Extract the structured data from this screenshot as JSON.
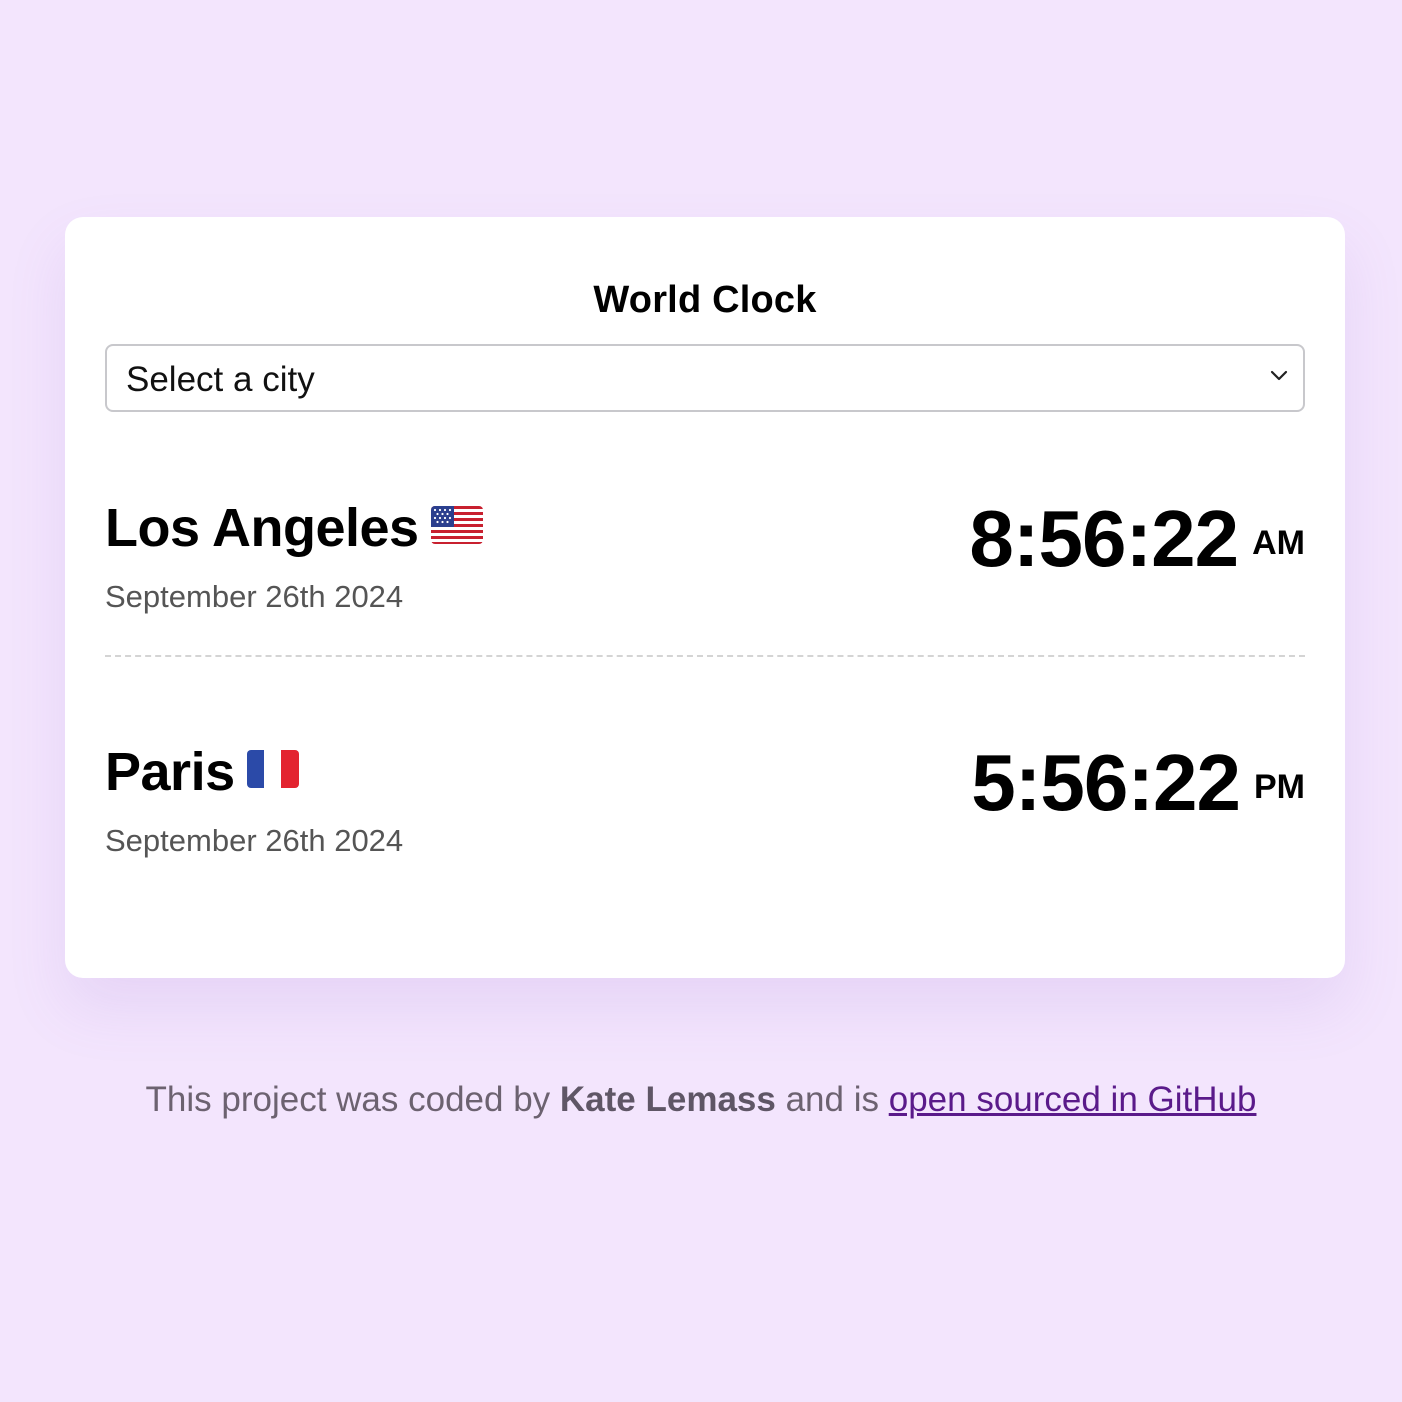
{
  "app": {
    "title": "World Clock"
  },
  "select": {
    "value": "Select a city",
    "icon": "chevron-down-icon"
  },
  "cities": [
    {
      "name": "Los Angeles",
      "flag": "us-flag-icon",
      "date": "September 26th 2024",
      "time": "8:56:22",
      "ampm": "AM"
    },
    {
      "name": "Paris",
      "flag": "france-flag-icon",
      "date": "September 26th 2024",
      "time": "5:56:22",
      "ampm": "PM"
    }
  ],
  "footer": {
    "prefix": "This project was coded by",
    "author": "Kate Lemass",
    "middle": "and is",
    "link_text": "open sourced in GitHub"
  },
  "colors": {
    "background": "#f3e5fd",
    "card": "#ffffff",
    "link": "#5a1a8a",
    "date_text": "#555555"
  }
}
